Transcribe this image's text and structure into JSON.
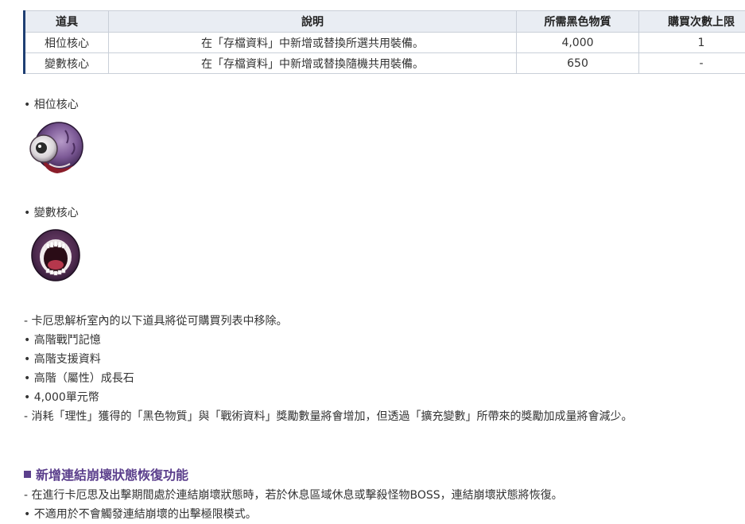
{
  "table": {
    "headers": [
      "道具",
      "說明",
      "所需黑色物質",
      "購買次數上限"
    ],
    "rows": [
      [
        "相位核心",
        "在「存檔資料」中新增或替換所選共用裝備。",
        "4,000",
        "1"
      ],
      [
        "變數核心",
        "在「存檔資料」中新增或替換隨機共用裝備。",
        "650",
        "-"
      ]
    ]
  },
  "items": {
    "phase_core": {
      "title": "• 相位核心",
      "icon": "eyeball-skull-icon"
    },
    "variable_core": {
      "title": "• 變數核心",
      "icon": "screaming-mouth-icon"
    }
  },
  "removal": {
    "intro": "- 卡厄思解析室內的以下道具將從可購買列表中移除。",
    "list": [
      "• 高階戰鬥記憶",
      "• 高階支援資料",
      "• 高階（屬性）成長石",
      "• 4,000單元幣"
    ],
    "note": "- 消耗「理性」獲得的「黑色物質」與「戰術資料」獎勵數量將會增加，但透過「擴充變數」所帶來的獎勵加成量將會減少。"
  },
  "section": {
    "title": "新增連結崩壞狀態恢復功能",
    "lines": [
      "- 在進行卡厄思及出擊期間處於連結崩壞狀態時，若於休息區域休息或擊殺怪物BOSS，連結崩壞狀態將恢復。",
      "• 不適用於不會觸發連結崩壞的出擊極限模式。"
    ]
  },
  "colors": {
    "accent": "#5b3f8c",
    "table_border_left": "#1f3f73",
    "table_header_bg": "#e9edf3"
  }
}
